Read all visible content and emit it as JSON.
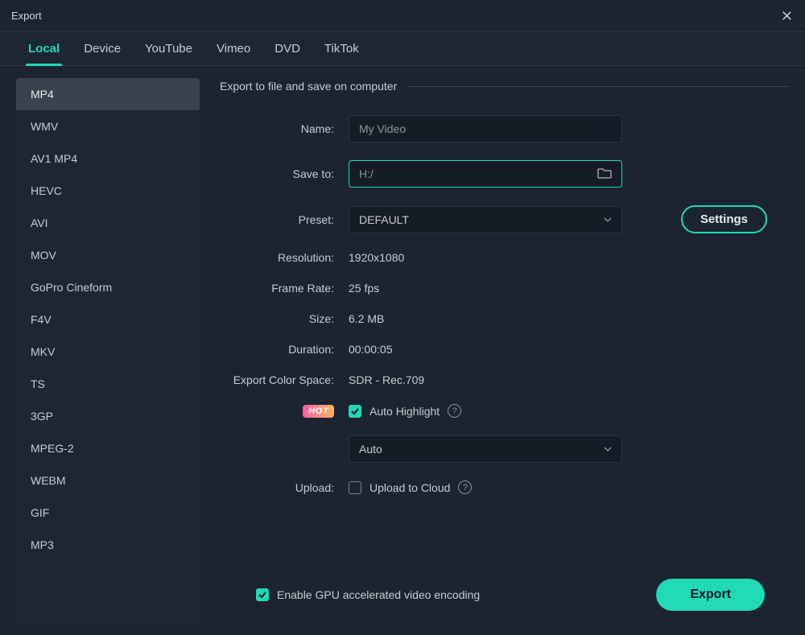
{
  "window": {
    "title": "Export"
  },
  "tabs": [
    {
      "label": "Local",
      "active": true
    },
    {
      "label": "Device",
      "active": false
    },
    {
      "label": "YouTube",
      "active": false
    },
    {
      "label": "Vimeo",
      "active": false
    },
    {
      "label": "DVD",
      "active": false
    },
    {
      "label": "TikTok",
      "active": false
    }
  ],
  "formats": [
    {
      "label": "MP4",
      "selected": true
    },
    {
      "label": "WMV"
    },
    {
      "label": "AV1 MP4"
    },
    {
      "label": "HEVC"
    },
    {
      "label": "AVI"
    },
    {
      "label": "MOV"
    },
    {
      "label": "GoPro Cineform"
    },
    {
      "label": "F4V"
    },
    {
      "label": "MKV"
    },
    {
      "label": "TS"
    },
    {
      "label": "3GP"
    },
    {
      "label": "MPEG-2"
    },
    {
      "label": "WEBM"
    },
    {
      "label": "GIF"
    },
    {
      "label": "MP3"
    }
  ],
  "section_heading": "Export to file and save on computer",
  "fields": {
    "name": {
      "label": "Name:",
      "value": "My Video"
    },
    "save_to": {
      "label": "Save to:",
      "value": "H:/"
    },
    "preset": {
      "label": "Preset:",
      "value": "DEFAULT",
      "settings_btn": "Settings"
    },
    "resolution": {
      "label": "Resolution:",
      "value": "1920x1080"
    },
    "frame_rate": {
      "label": "Frame Rate:",
      "value": "25 fps"
    },
    "size": {
      "label": "Size:",
      "value": "6.2 MB"
    },
    "duration": {
      "label": "Duration:",
      "value": "00:00:05"
    },
    "color_space": {
      "label": "Export Color Space:",
      "value": "SDR - Rec.709"
    },
    "auto_highlight": {
      "badge": "HOT",
      "label": "Auto Highlight",
      "checked": true,
      "mode": "Auto"
    },
    "upload": {
      "label": "Upload:",
      "checkbox_label": "Upload to Cloud",
      "checked": false
    }
  },
  "footer": {
    "gpu_label": "Enable GPU accelerated video encoding",
    "gpu_checked": true,
    "export_btn": "Export"
  }
}
